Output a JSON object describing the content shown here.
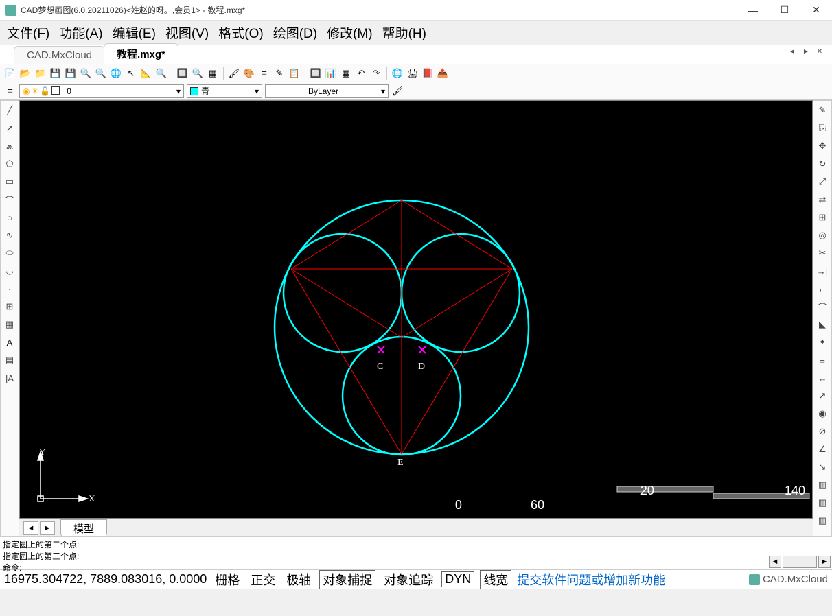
{
  "window": {
    "title": "CAD梦想画图(6.0.20211026)<姓赵的呀。,会员1> - 教程.mxg*",
    "min_icon": "—",
    "max_icon": "☐",
    "close_icon": "✕"
  },
  "menu": {
    "file": "文件(F)",
    "func": "功能(A)",
    "edit": "编辑(E)",
    "view": "视图(V)",
    "format": "格式(O)",
    "draw": "绘图(D)",
    "modify": "修改(M)",
    "help": "帮助(H)"
  },
  "tabs": {
    "t1": "CAD.MxCloud",
    "t2": "教程.mxg*",
    "left_arrow": "◄",
    "right_arrow": "►",
    "close_x": "✕"
  },
  "props": {
    "layer_value": "0",
    "color_value": "青",
    "linetype_value": "ByLayer",
    "color_hex": "#00ffff"
  },
  "canvas": {
    "labels": {
      "C": "C",
      "D": "D",
      "E": "E",
      "X": "X",
      "Y": "Y"
    },
    "scale": {
      "a": "20",
      "b": "140",
      "c": "0",
      "d": "60"
    }
  },
  "bottom_tabs": {
    "prev": "◄",
    "next": "►",
    "model": "模型"
  },
  "cmd": {
    "line1": "指定圆上的第二个点:",
    "line2": "指定圆上的第三个点:",
    "prompt": "命令:",
    "sb_left": "◄",
    "sb_right": "►"
  },
  "status": {
    "coords": "16975.304722, 7889.083016, 0.0000",
    "grid": "栅格",
    "ortho": "正交",
    "polar": "极轴",
    "osnap": "对象捕捉",
    "otrack": "对象追踪",
    "dyn": "DYN",
    "lweight": "线宽",
    "link": "提交软件问题或增加新功能",
    "brand": "CAD.MxCloud"
  }
}
